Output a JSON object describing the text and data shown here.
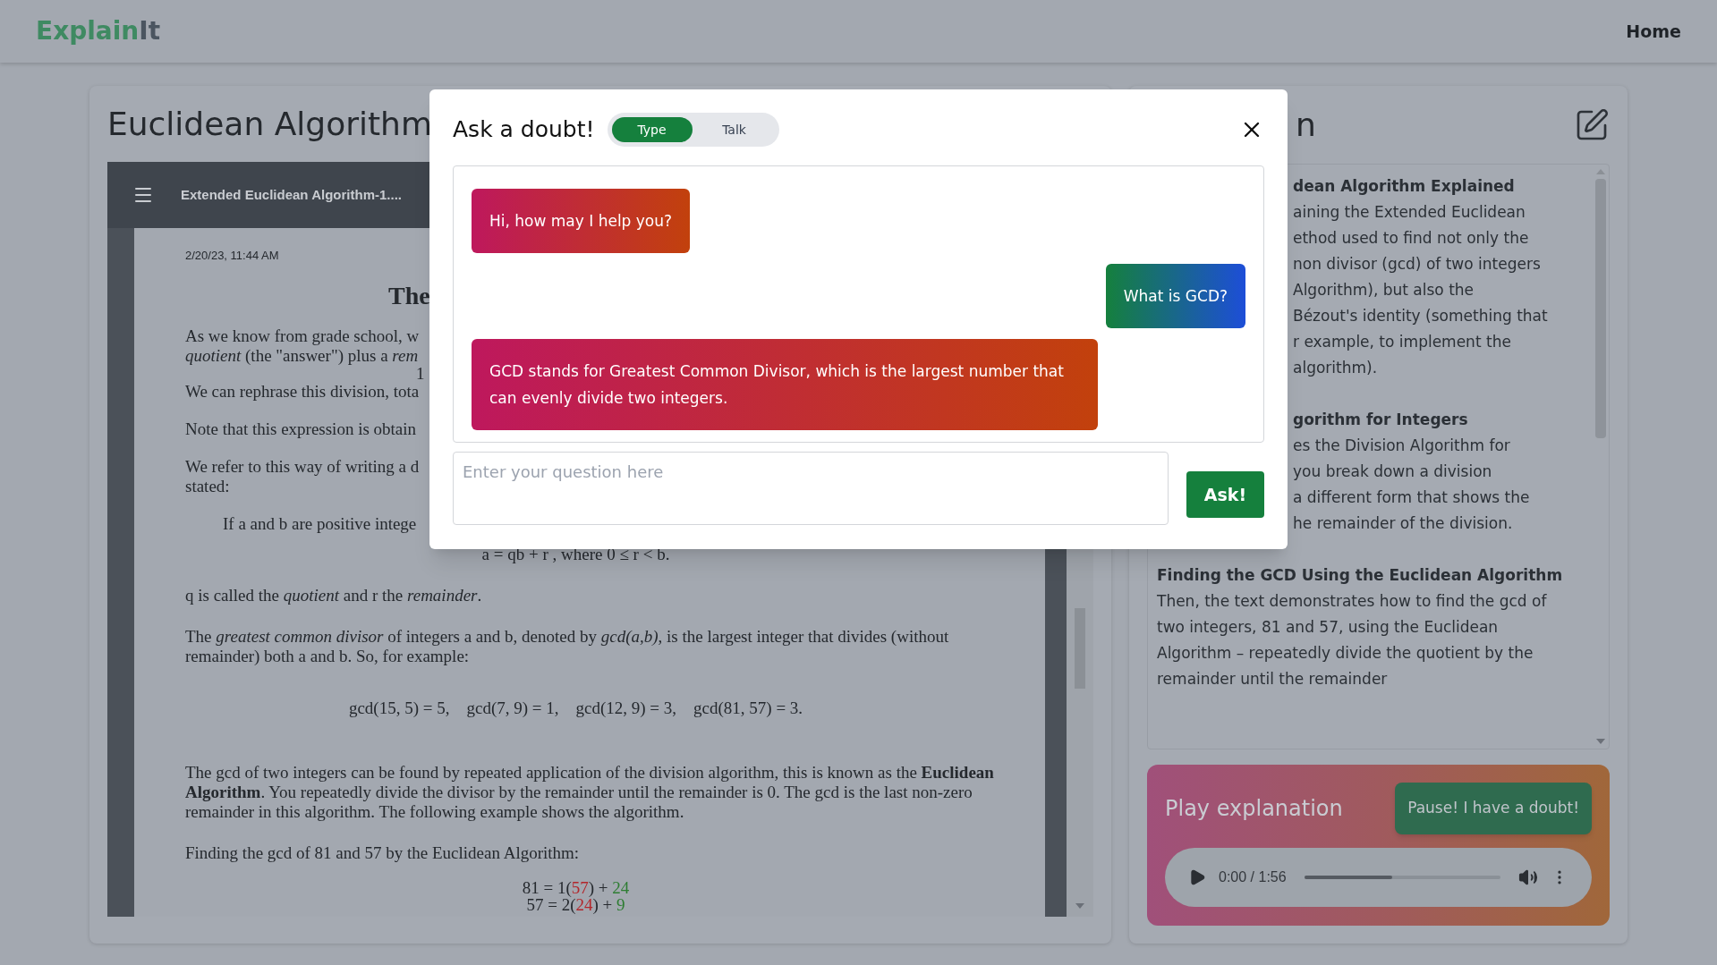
{
  "navbar": {
    "logo": [
      {
        "text": "Explain",
        "color": "#3f8a62"
      },
      {
        "text": "It",
        "color": "#4b5560"
      }
    ],
    "links": [
      {
        "label": "Home"
      }
    ]
  },
  "lesson": {
    "title": "Euclidean Algorithm",
    "pdf": {
      "file_name": "Extended Euclidean Algorithm-1....",
      "date": "2/20/23, 11:44 AM",
      "heading": "The",
      "top_fragments": [
        {
          "kind": "line",
          "text": "As we know from grade school, w"
        },
        {
          "kind": "line",
          "text": "*quotient* (the \"answer\") plus a *rem*"
        },
        {
          "kind": "number",
          "text": "1"
        },
        {
          "kind": "line",
          "text": "We can rephrase this division, tota"
        },
        {
          "kind": "gap_line",
          "text": "Note that this expression is obtain"
        },
        {
          "kind": "gap_line",
          "text": "We refer to this way of writing a d"
        },
        {
          "kind": "line",
          "text": "stated:"
        },
        {
          "kind": "indent",
          "text": "If a and b are positive intege"
        }
      ],
      "body": [
        {
          "kind": "center",
          "text": "a = qb + r , where 0 ≤ r < b."
        },
        {
          "kind": "para",
          "text": "q is called the *quotient* and r the *remainder*."
        },
        {
          "kind": "para",
          "text": "The *greatest common divisor* of integers a and b, denoted by *gcd(a,b)*, is the largest integer that divides (without remainder) both a and b. So, for example:"
        },
        {
          "kind": "formula",
          "text": "gcd(15, 5) = 5,    gcd(7, 9) = 1,    gcd(12, 9) = 3,    gcd(81, 57) = 3."
        },
        {
          "kind": "para",
          "text": "The gcd of two integers can be found by repeated application of the division algorithm, this is known as the **Euclidean Algorithm**. You repeatedly divide the divisor by the remainder until the remainder is 0. The gcd is the last non-zero remainder in this algorithm. The following example shows the algorithm."
        },
        {
          "kind": "para",
          "text": "Finding the gcd of 81 and 57 by the Euclidean Algorithm:"
        }
      ],
      "steps": [
        [
          {
            "text": "81 = 1(",
            "color": "#25292e"
          },
          {
            "text": "57",
            "color": "#b3262b"
          },
          {
            "text": ") + ",
            "color": "#25292e"
          },
          {
            "text": "24",
            "color": "#2e7d32"
          }
        ],
        [
          {
            "text": "57 = 2(",
            "color": "#25292e"
          },
          {
            "text": "24",
            "color": "#b3262b"
          },
          {
            "text": ") + ",
            "color": "#25292e"
          },
          {
            "text": "9",
            "color": "#2e7d32"
          }
        ]
      ]
    }
  },
  "explanation": {
    "title_fragment": "n",
    "sections": [
      {
        "kind": "covered",
        "heading": "dean Algorithm Explained",
        "lines": [
          "aining the Extended Euclidean",
          "ethod used to find not only the",
          "non divisor (gcd) of two integers",
          "Algorithm), but also the",
          "Bézout's identity (something that",
          "r example, to implement the",
          "algorithm)."
        ]
      },
      {
        "kind": "covered",
        "heading": "gorithm for Integers",
        "lines": [
          "es the Division Algorithm for",
          "you break down a division",
          "a different form that shows the",
          "he remainder of the division."
        ]
      },
      {
        "kind": "full",
        "heading": "Finding the GCD Using the Euclidean Algorithm",
        "lines": [
          "Then, the text demonstrates how to find the gcd of two integers, 81 and 57, using the Euclidean Algorithm – repeatedly divide the quotient by the remainder until the remainder"
        ]
      }
    ],
    "player": {
      "label": "Play explanation",
      "doubt_button": "Pause! I have a doubt!",
      "time": "0:00 / 1:56",
      "level": 0.45
    }
  },
  "dialog": {
    "title": "Ask a doubt!",
    "modes": [
      {
        "label": "Type",
        "selected": true
      },
      {
        "label": "Talk",
        "selected": false
      }
    ],
    "messages": [
      {
        "kind": "bot",
        "text": "Hi, how may I help you?"
      },
      {
        "kind": "user",
        "text": "What is GCD?"
      },
      {
        "kind": "bot",
        "text": "GCD stands for Greatest Common Divisor, which is the largest number that can evenly divide two integers."
      }
    ],
    "input": {
      "placeholder": "Enter your question here"
    },
    "ask_button": "Ask!"
  }
}
